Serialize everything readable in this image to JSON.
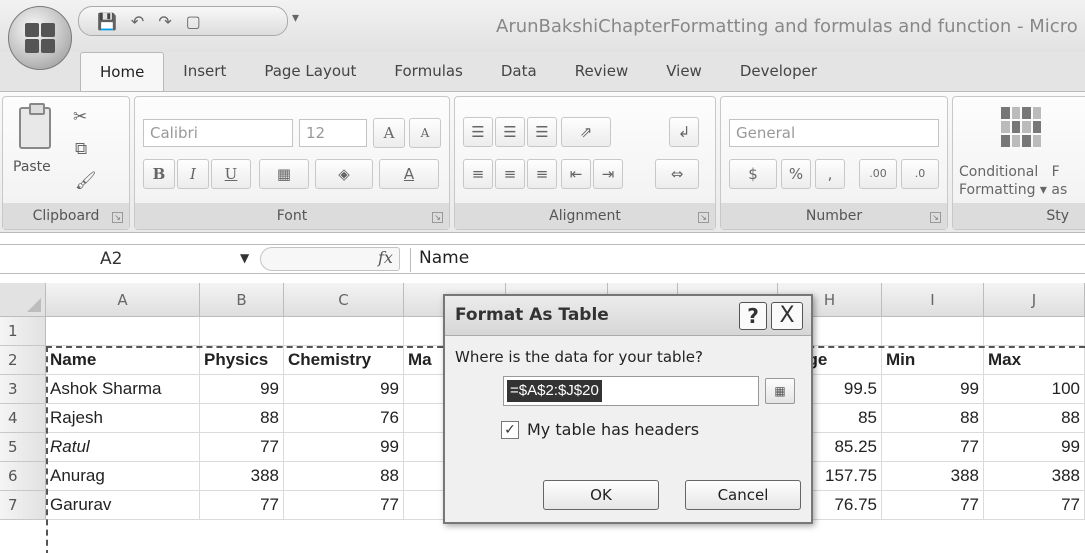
{
  "window": {
    "title": "ArunBakshiChapterFormatting and formulas and function - Micro"
  },
  "tabs": [
    "Home",
    "Insert",
    "Page Layout",
    "Formulas",
    "Data",
    "Review",
    "View",
    "Developer"
  ],
  "ribbon": {
    "clipboard": {
      "label": "Clipboard",
      "paste": "Paste"
    },
    "font": {
      "label": "Font",
      "name": "Calibri",
      "size": "12",
      "grow": "A",
      "shrink": "A",
      "bold": "B",
      "italic": "I",
      "underline": "U"
    },
    "alignment": {
      "label": "Alignment"
    },
    "number": {
      "label": "Number",
      "format": "General",
      "currency": "$",
      "percent": "%",
      "comma": ",",
      "inc_dec": ".00",
      "dec_dec": ".0"
    },
    "styles": {
      "label": "Sty",
      "conditional_line1": "Conditional",
      "conditional_line2": "Formatting",
      "conditional_suffix": "F",
      "format_as_table_fragment": "as"
    }
  },
  "formula_bar": {
    "cell_ref": "A2",
    "fx": "fx",
    "value": "Name"
  },
  "grid": {
    "columns": [
      "A",
      "B",
      "C",
      "",
      "",
      "",
      "",
      "H",
      "I",
      "J"
    ],
    "rows": [
      {
        "n": "1",
        "cells": [
          "",
          "",
          "",
          "",
          "",
          "",
          "",
          "",
          "",
          ""
        ]
      },
      {
        "n": "2",
        "cells": [
          "Name",
          "Physics",
          "Chemistry",
          "Ma",
          "",
          "",
          "",
          "erage",
          "Min",
          "Max"
        ]
      },
      {
        "n": "3",
        "cells": [
          "Ashok Sharma",
          "99",
          "99",
          "",
          "",
          "",
          "",
          "99.5",
          "99",
          "100"
        ]
      },
      {
        "n": "4",
        "cells": [
          "Rajesh",
          "88",
          "76",
          "",
          "",
          "",
          "",
          "85",
          "88",
          "88"
        ]
      },
      {
        "n": "5",
        "cells": [
          "Ratul",
          "77",
          "99",
          "",
          "",
          "",
          "",
          "85.25",
          "77",
          "99"
        ]
      },
      {
        "n": "6",
        "cells": [
          "Anurag",
          "388",
          "88",
          "",
          "",
          "",
          "",
          "157.75",
          "388",
          "388"
        ]
      },
      {
        "n": "7",
        "cells": [
          "Garurav",
          "77",
          "77",
          "",
          "",
          "",
          "",
          "76.75",
          "77",
          "77"
        ]
      }
    ]
  },
  "dialog": {
    "title": "Format As Table",
    "help": "?",
    "close": "X",
    "prompt": "Where is the data for your table?",
    "range": "=$A$2:$J$20",
    "checkbox_label": "My table has headers",
    "checkbox_checked": true,
    "ok": "OK",
    "cancel": "Cancel"
  }
}
